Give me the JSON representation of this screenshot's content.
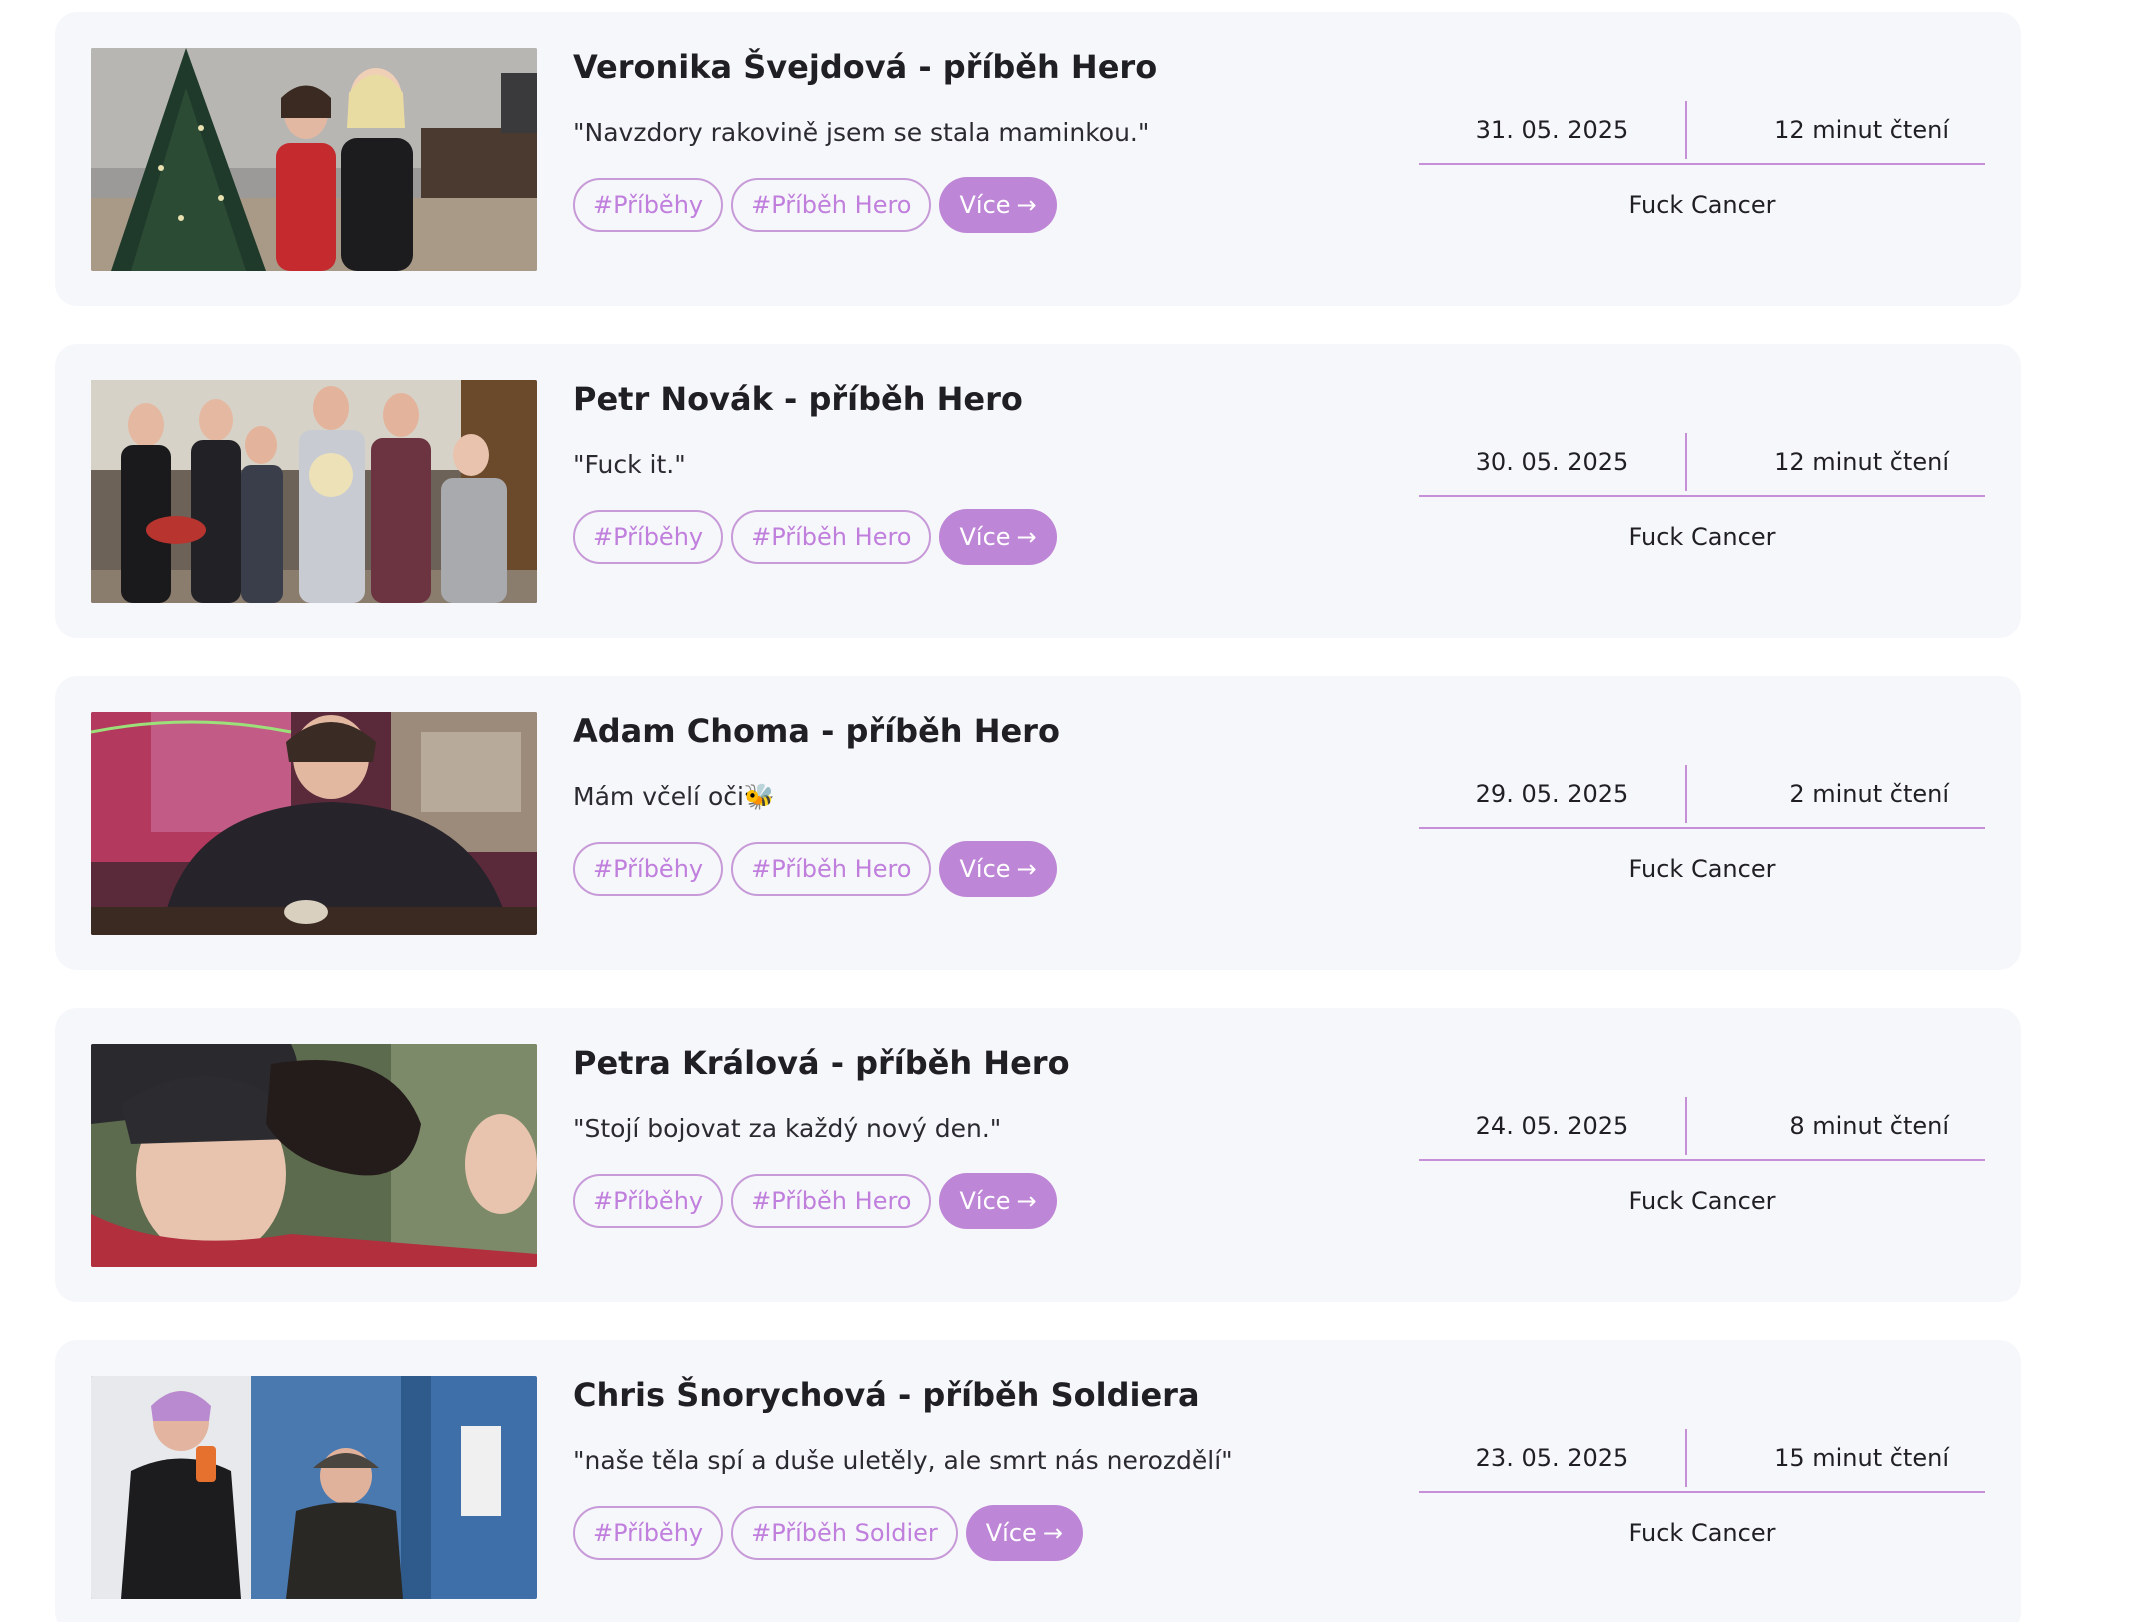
{
  "articles": [
    {
      "title": "Veronika Švejdová - příběh Hero",
      "quote": "\"Navzdory rakovině jsem se stala maminkou.\"",
      "tags": [
        "#Příběhy",
        "#Příběh Hero"
      ],
      "more_label": "Více",
      "date": "31. 05. 2025",
      "read_time": "12 minut čtení",
      "author": "Fuck Cancer",
      "photo_description": "mother and daughter by a christmas tree"
    },
    {
      "title": "Petr Novák - příběh Hero",
      "quote": "\"Fuck it.\"",
      "tags": [
        "#Příběhy",
        "#Příběh Hero"
      ],
      "more_label": "Více",
      "date": "30. 05. 2025",
      "read_time": "12 minut čtení",
      "author": "Fuck Cancer",
      "photo_description": "family group photo"
    },
    {
      "title": "Adam Choma - příběh Hero",
      "quote": "Mám včelí oči🐝",
      "tags": [
        "#Příběhy",
        "#Příběh Hero"
      ],
      "more_label": "Více",
      "date": "29. 05. 2025",
      "read_time": "2 minut čtení",
      "author": "Fuck Cancer",
      "photo_description": "young man in a cafe"
    },
    {
      "title": "Petra Králová - příběh Hero",
      "quote": "\"Stojí bojovat za každý nový den.\"",
      "tags": [
        "#Příběhy",
        "#Příběh Hero"
      ],
      "more_label": "Více",
      "date": "24. 05. 2025",
      "read_time": "8 minut čtení",
      "author": "Fuck Cancer",
      "photo_description": "woman with a horse"
    },
    {
      "title": "Chris Šnorychová - příběh Soldiera",
      "quote": "\"naše těla spí a duše uletěly, ale smrt nás nerozdělí\"",
      "tags": [
        "#Příběhy",
        "#Příběh Soldier"
      ],
      "more_label": "Více",
      "date": "23. 05. 2025",
      "read_time": "15 minut čtení",
      "author": "Fuck Cancer",
      "photo_description": "two people in a mirror selfie"
    }
  ],
  "colors": {
    "card_bg": "#f6f7fb",
    "accent": "#be86d6",
    "tag_border": "#c79ad8",
    "tag_text": "#c07fdd",
    "line": "#c590d8"
  },
  "icons": {
    "more_arrow": "arrow-right-icon"
  }
}
